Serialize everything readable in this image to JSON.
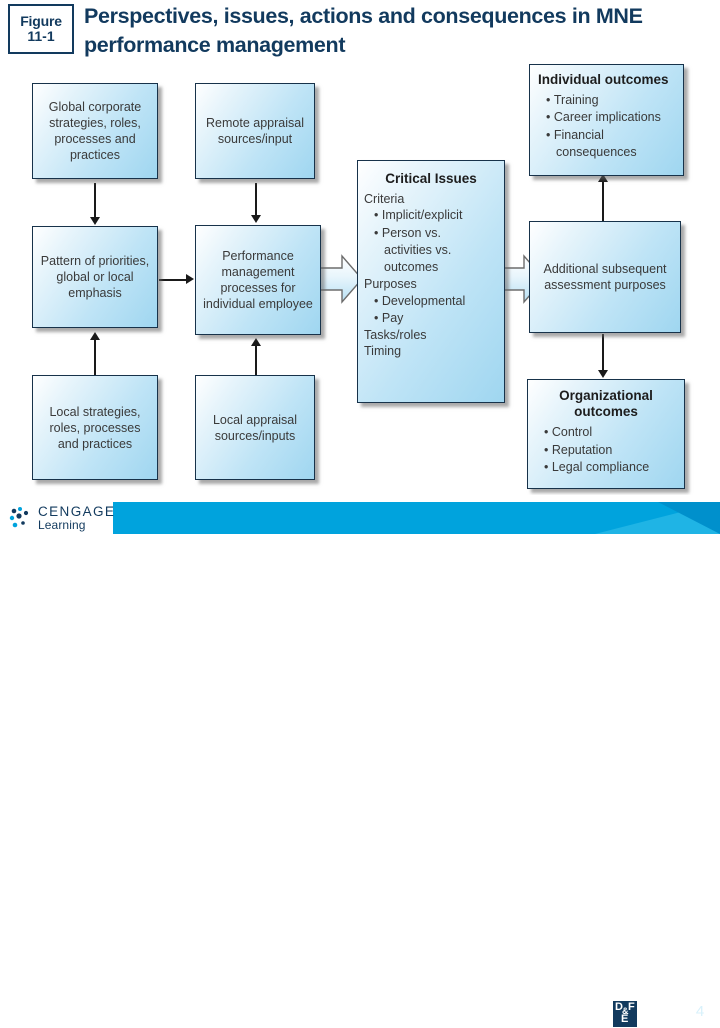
{
  "header": {
    "figure_label": "Figure",
    "figure_number": "11-1",
    "title": "Perspectives, issues, actions and consequences in MNE performance management"
  },
  "diagram": {
    "boxes": {
      "global_corporate": {
        "text": "Global corporate strategies, roles, processes and practices"
      },
      "pattern": {
        "text": "Pattern of priorities, global or local emphasis"
      },
      "local_strategies": {
        "text": "Local strategies, roles, processes and practices"
      },
      "remote_appraisal": {
        "text": "Remote appraisal sources/input"
      },
      "performance_mgmt": {
        "text": "Performance management processes for individual employee"
      },
      "local_appraisal": {
        "text": "Local appraisal sources/inputs"
      },
      "critical_issues": {
        "heading": "Critical Issues",
        "criteria_label": "Criteria",
        "criteria_items": [
          "Implicit/explicit",
          "Person vs.",
          "activities vs.",
          "outcomes"
        ],
        "purposes_label": "Purposes",
        "purposes_items": [
          "Developmental",
          "Pay"
        ],
        "tasks_roles": "Tasks/roles",
        "timing": "Timing"
      },
      "individual_outcomes": {
        "heading": "Individual outcomes",
        "items": [
          "Training",
          "Career implications",
          "Financial",
          "consequences"
        ]
      },
      "additional_subsequent": {
        "text": "Additional subsequent assessment purposes"
      },
      "organizational_outcomes": {
        "heading_line1": "Organizational",
        "heading_line2": "outcomes",
        "items": [
          "Control",
          "Reputation",
          "Legal compliance"
        ]
      }
    },
    "colors": {
      "box_border": "#17324a",
      "box_fill_light": "#e6f4fb",
      "box_fill_dark": "#9fd6f0",
      "connector": "#1a1a1a",
      "title": "#123a5e"
    }
  },
  "footer": {
    "brand_line1": "CENGAGE",
    "brand_line2": "Learning",
    "dfe_d": "D",
    "dfe_amp": "&",
    "dfe_f": "F",
    "dfe_e": "E",
    "page_number": "4",
    "bar_color": "#00a3dd"
  }
}
